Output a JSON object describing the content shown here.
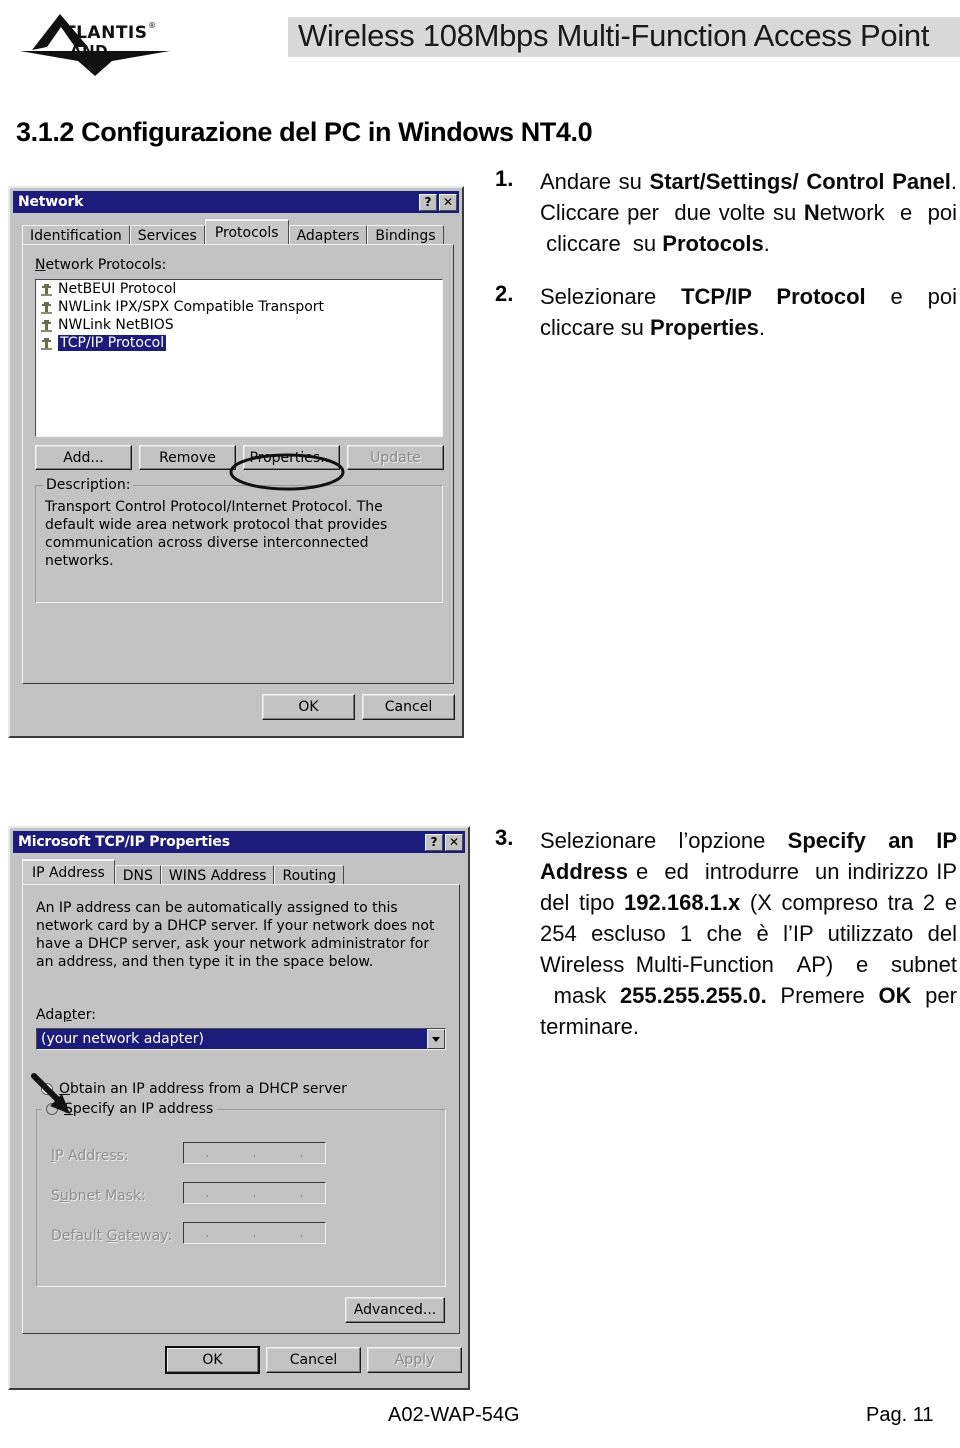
{
  "header": {
    "logo_name": "ATLANTIS LAND",
    "logo_word_top": "TLANTIS",
    "logo_word_bottom": "AND",
    "logo_reg": "®",
    "title": "Wireless 108Mbps Multi-Function Access Point",
    "band_color": "#d9d9d9"
  },
  "section": {
    "heading": "3.1.2 Configurazione del  PC in Windows NT4.0"
  },
  "steps": [
    {
      "number": "1.",
      "html": "Andare su <b>Start/Settings/ Control Panel</b>. Cliccare per &nbsp;due volte su <b>N</b>etwork &nbsp;e &nbsp;poi &nbsp;cliccare &nbsp;su <b>Protocols</b>."
    },
    {
      "number": "2.",
      "html": "Selezionare <b>TCP/IP Protocol</b> e poi cliccare su <b>Properties</b>."
    },
    {
      "number": "3.",
      "html": "Selezionare l’opzione <b>Specify an IP Address</b> e &nbsp;ed &nbsp;introdurre &nbsp;un indirizzo IP del tipo <b>192.168.1.x</b> (X compreso tra 2 e 254 escluso 1 che è l’IP utilizzato del Wireless Multi-Function &nbsp;AP) &nbsp;e &nbsp;subnet &nbsp;mask <b>255.255.255.0.</b> Premere <b>OK</b> per terminare."
    }
  ],
  "network_dialog": {
    "title": "Network",
    "help_button": "?",
    "close_button": "✕",
    "tabs": [
      {
        "label": "Identification",
        "active": false
      },
      {
        "label": "Services",
        "active": false
      },
      {
        "label": "Protocols",
        "active": true
      },
      {
        "label": "Adapters",
        "active": false
      },
      {
        "label": "Bindings",
        "active": false
      }
    ],
    "list_label": "Network Protocols:",
    "protocols": [
      {
        "label": "NetBEUI Protocol",
        "selected": false
      },
      {
        "label": "NWLink IPX/SPX Compatible Transport",
        "selected": false
      },
      {
        "label": "NWLink NetBIOS",
        "selected": false
      },
      {
        "label": "TCP/IP Protocol",
        "selected": true
      }
    ],
    "buttons": {
      "add": "Add...",
      "remove": "Remove",
      "properties": "Properties...",
      "update": "Update"
    },
    "description_label": "Description:",
    "description_text": "Transport Control Protocol/Internet Protocol. The default wide area network protocol that provides communication across diverse interconnected networks.",
    "ok": "OK",
    "cancel": "Cancel",
    "annotation": "ellipse-around-properties-button"
  },
  "tcpip_dialog": {
    "title": "Microsoft TCP/IP Properties",
    "help_button": "?",
    "close_button": "✕",
    "tabs": [
      {
        "label": "IP Address",
        "active": true
      },
      {
        "label": "DNS",
        "active": false
      },
      {
        "label": "WINS Address",
        "active": false
      },
      {
        "label": "Routing",
        "active": false
      }
    ],
    "info_text": "An IP address can be automatically assigned to this network card by a DHCP server.  If your network does not have a DHCP server, ask your network administrator for an address, and then type it in the space below.",
    "adapter_label": "Adapter:",
    "adapter_value": "(your network adapter)",
    "radio_dhcp": "Obtain an IP address from a DHCP server",
    "radio_static": "Specify an IP address",
    "fields": [
      {
        "label": "IP Address:",
        "value": ""
      },
      {
        "label": "Subnet Mask:",
        "value": ""
      },
      {
        "label": "Default Gateway:",
        "value": ""
      }
    ],
    "advanced": "Advanced...",
    "ok": "OK",
    "cancel": "Cancel",
    "apply": "Apply",
    "annotation": "arrow-pointing-to-dhcp-radio"
  },
  "footer": {
    "left": "A02-WAP-54G",
    "right": "Pag. 11"
  },
  "colors": {
    "titlebar": "#1c1c7a",
    "dialog_face": "#c3c3c3",
    "header_band": "#d9d9d9"
  }
}
